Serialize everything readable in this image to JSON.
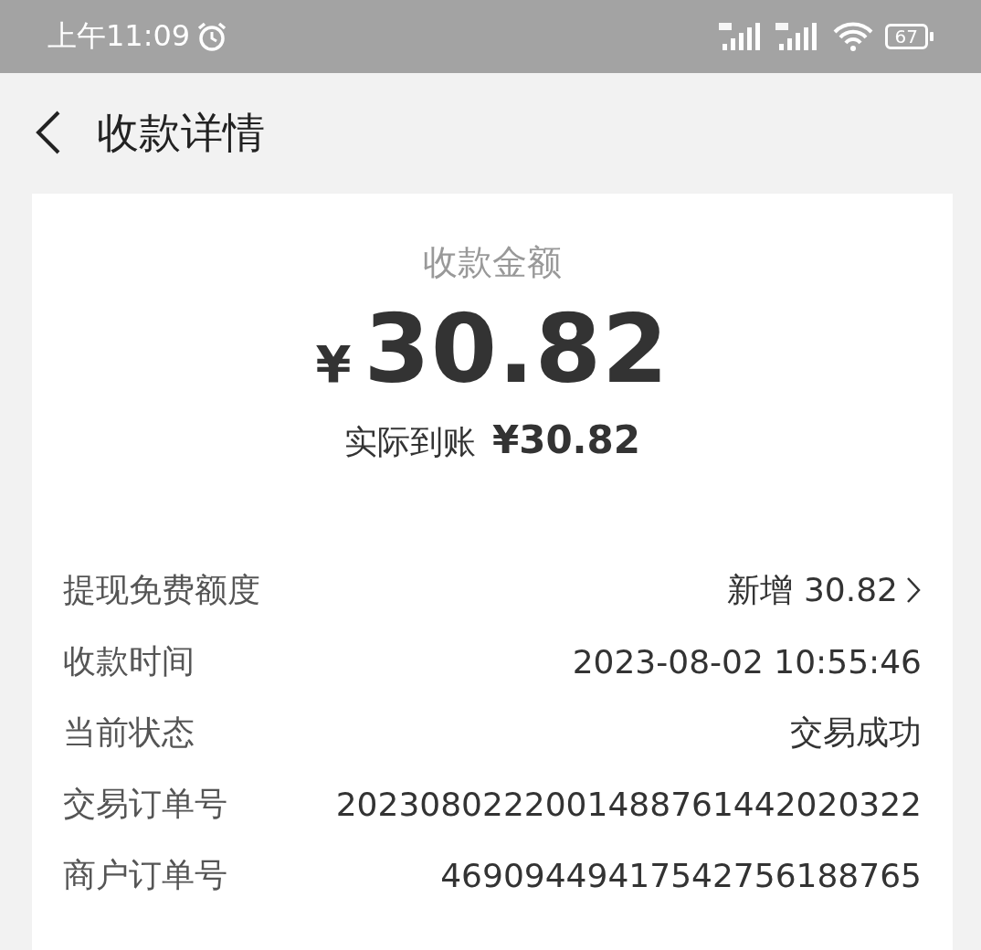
{
  "status_bar": {
    "time": "上午11:09",
    "battery": "67"
  },
  "header": {
    "title": "收款详情"
  },
  "summary": {
    "label": "收款金额",
    "currency": "¥",
    "amount": "30.82",
    "received_label": "实际到账",
    "received_value": "¥30.82"
  },
  "rows": [
    {
      "label": "提现免费额度",
      "value": "新增 30.82",
      "kind": "link"
    },
    {
      "label": "收款时间",
      "value": "2023-08-02 10:55:46",
      "kind": "plain"
    },
    {
      "label": "当前状态",
      "value": "交易成功",
      "kind": "plain"
    },
    {
      "label": "交易订单号",
      "value": "2023080222001488761442020322",
      "kind": "plain"
    },
    {
      "label": "商户订单号",
      "value": "46909449417542756188765",
      "kind": "plain"
    }
  ]
}
